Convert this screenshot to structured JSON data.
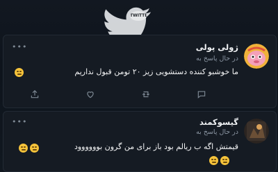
{
  "logo": {
    "icon": "twitter-bird-icon",
    "badge_text": "TWITTER IRAN"
  },
  "tweets": [
    {
      "name": "ژولی پولی",
      "reply_label": "در حال پاسخ به",
      "text": "ما خوشبو کننده دستشویی زیز ۲۰ تومن قبول نداریم",
      "emoji": "face-with-sweat-icon"
    },
    {
      "name": "گیسوکمند",
      "reply_label": "در حال پاسخ به",
      "text": "قیمتش اگه ب ریالم بود باز برای من گرون بوووووود",
      "emoji": "expressionless-face-icon"
    }
  ],
  "actions": [
    "reply-icon",
    "retweet-icon",
    "like-icon",
    "share-icon"
  ],
  "colors": {
    "background": "#0d1117",
    "card": "#151b23",
    "text": "#f4f5f6",
    "muted": "#8b96a3",
    "emoji": "#f5c33b"
  }
}
